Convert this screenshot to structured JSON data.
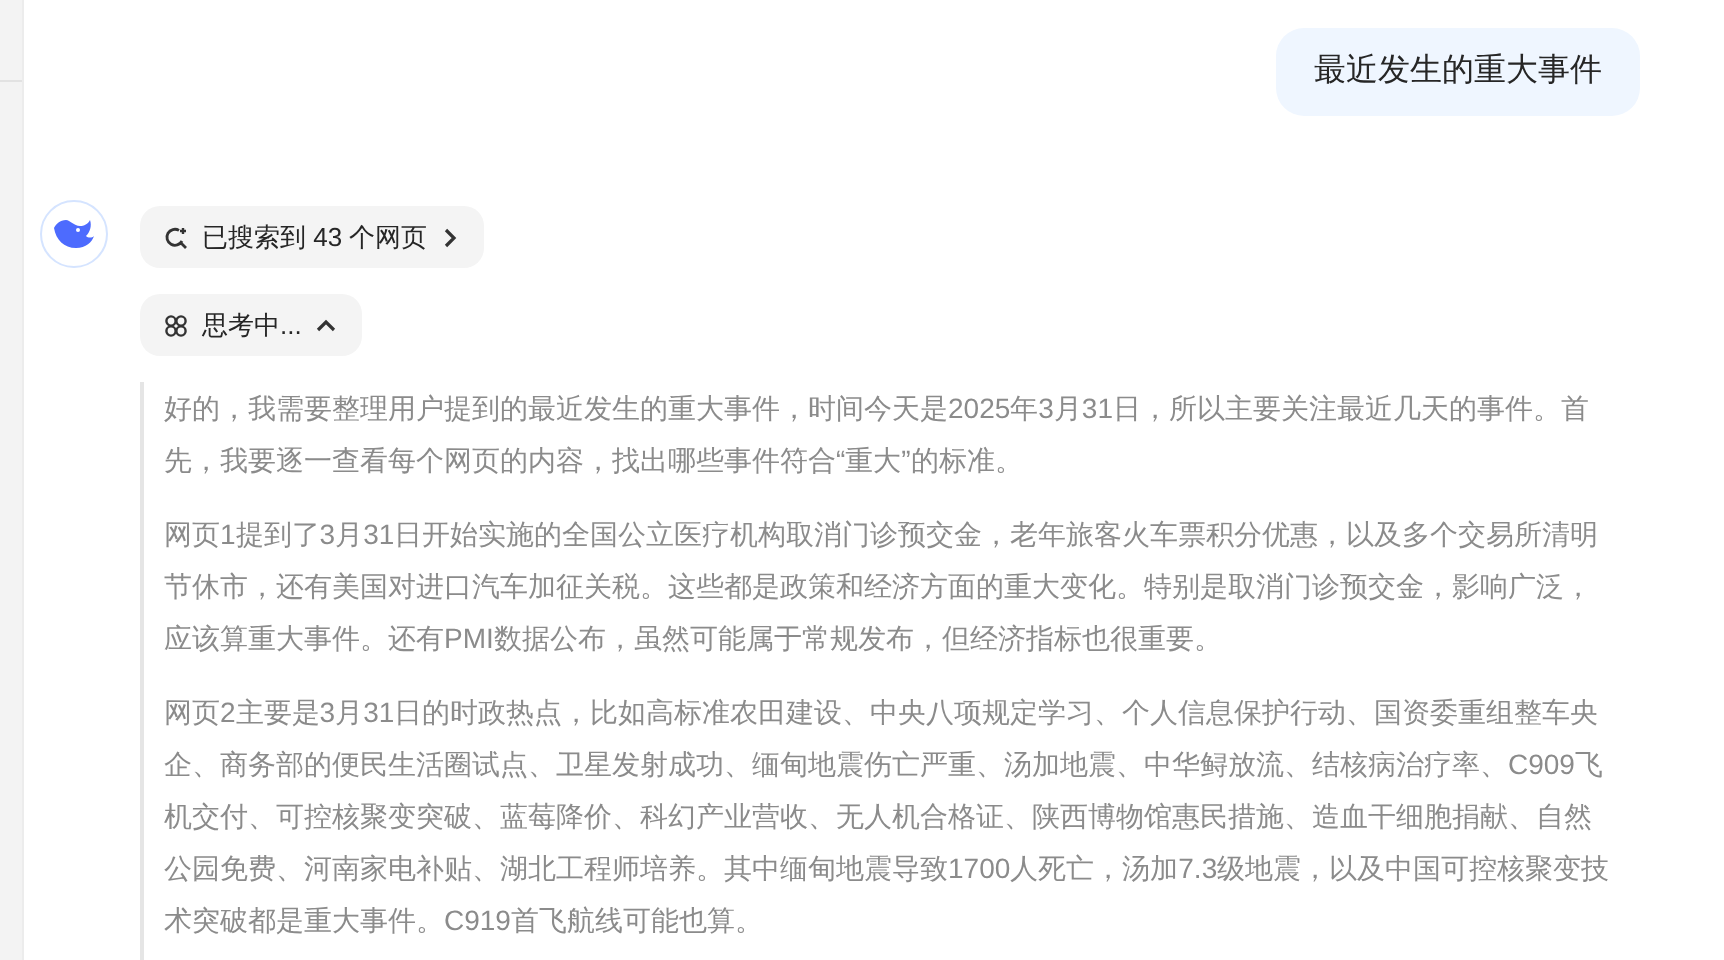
{
  "user_message": "最近发生的重大事件",
  "search_status": {
    "label": "已搜索到 43 个网页"
  },
  "thinking": {
    "label": "思考中...",
    "expanded": true
  },
  "thought_paragraphs": [
    "好的，我需要整理用户提到的最近发生的重大事件，时间今天是2025年3月31日，所以主要关注最近几天的事件。首先，我要逐一查看每个网页的内容，找出哪些事件符合“重大”的标准。",
    "网页1提到了3月31日开始实施的全国公立医疗机构取消门诊预交金，老年旅客火车票积分优惠，以及多个交易所清明节休市，还有美国对进口汽车加征关税。这些都是政策和经济方面的重大变化。特别是取消门诊预交金，影响广泛，应该算重大事件。还有PMI数据公布，虽然可能属于常规发布，但经济指标也很重要。",
    "网页2主要是3月31日的时政热点，比如高标准农田建设、中央八项规定学习、个人信息保护行动、国资委重组整车央企、商务部的便民生活圈试点、卫星发射成功、缅甸地震伤亡严重、汤加地震、中华鲟放流、结核病治疗率、C909飞机交付、可控核聚变突破、蓝莓降价、科幻产业营收、无人机合格证、陕西博物馆惠民措施、造血干细胞捐献、自然公园免费、河南家电补贴、湖北工程师培养。其中缅甸地震导致1700人死亡，汤加7.3级地震，以及中国可控核聚变技术突破都是重大事件。C919首飞航线可能也算。"
  ]
}
